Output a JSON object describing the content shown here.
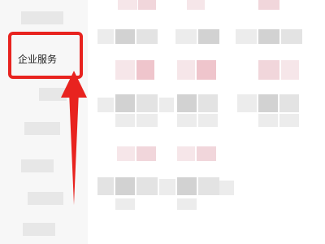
{
  "sidebar": {
    "selected_item_label": "企业服务"
  },
  "annotation": {
    "highlight_color": "#e8231f",
    "arrow_color": "#e8231f"
  }
}
